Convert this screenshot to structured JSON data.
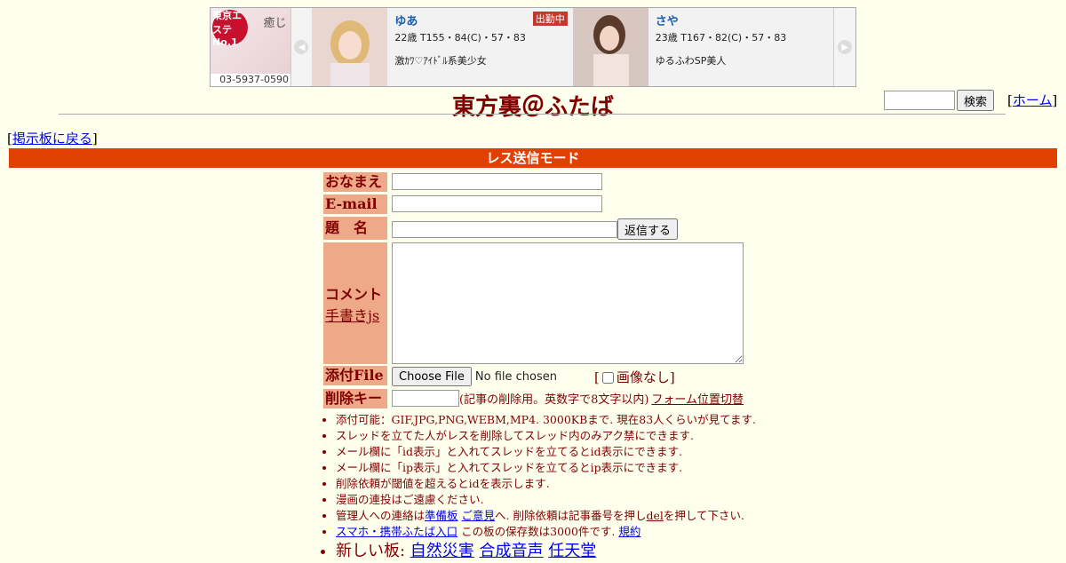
{
  "banner": {
    "shop_badge": "東京エステNo.1",
    "shop_sub": "癒じ",
    "shop_phone": "03-5937-0590",
    "girls": [
      {
        "name": "ゆあ",
        "stats": "22歳 T155・84(C)・57・83",
        "catch": "激ｶﾜ♡ｱｲﾄﾞﾙ系美少女",
        "status": "出勤中"
      },
      {
        "name": "さや",
        "stats": "23歳 T167・82(C)・57・83",
        "catch": "ゆるふわSP美人",
        "status": ""
      }
    ]
  },
  "header": {
    "title": "東方裏＠ふたば",
    "search_button": "検索",
    "home_link": "ホーム",
    "back_link": "掲示板に戻る"
  },
  "mode": "レス送信モード",
  "form": {
    "name_label": "おなまえ",
    "email_label": "E-mail",
    "subject_label": "題　名",
    "reply_button": "返信する",
    "comment_label": "コメント",
    "handwrite_link": "手書きjs",
    "file_label": "添付File",
    "file_button": "Choose File",
    "file_status": "No file chosen",
    "no_image_label": "画像なし",
    "delkey_label": "削除キー",
    "delkey_note": "(記事の削除用。英数字で8文字以内)",
    "form_switch_link": "フォーム位置切替"
  },
  "rules": {
    "r1": "添付可能：GIF,JPG,PNG,WEBM,MP4. 3000KBまで. 現在83人くらいが見てます.",
    "r2": "スレッドを立てた人がレスを削除してスレッド内のみアク禁にできます.",
    "r3": "メール欄に「id表示」と入れてスレッドを立てるとid表示にできます.",
    "r4": "メール欄に「ip表示」と入れてスレッドを立てるとip表示にできます.",
    "r5": "削除依頼が閾値を超えるとidを表示します.",
    "r6": "漫画の連投はご遠慮ください.",
    "r7_pre": "管理人への連絡は",
    "r7_link1": "準備板",
    "r7_link2": "ご意見",
    "r7_mid": "へ. 削除依頼は記事番号を押し",
    "r7_link3": "del",
    "r7_post": "を押して下さい.",
    "r8_link": "スマホ・携帯ふたば入口",
    "r8_mid": " この板の保存数は3000件です. ",
    "r8_link2": "規約",
    "r9_pre": "新しい板: ",
    "r9_link1": "自然災害",
    "r9_link2": "合成音声",
    "r9_link3": "任天堂"
  }
}
